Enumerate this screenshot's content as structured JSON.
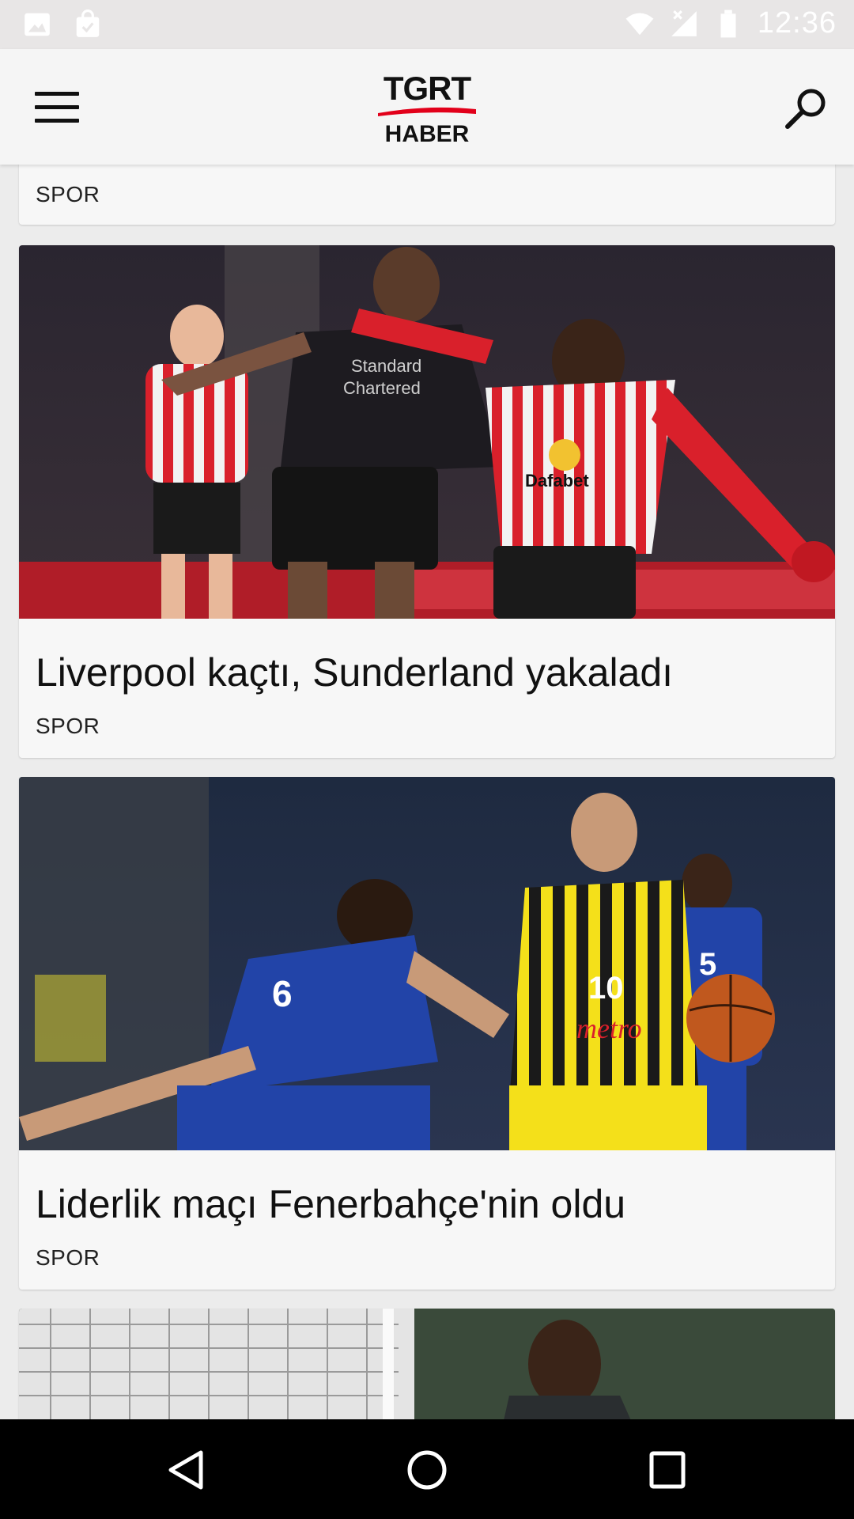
{
  "status_bar": {
    "time": "12:36",
    "icons": [
      "image-icon",
      "shopping-bag-icon",
      "wifi-icon",
      "signal-icon",
      "battery-icon"
    ]
  },
  "app_bar": {
    "logo_line1": "TGRT",
    "logo_line2": "HABER",
    "menu_icon": "hamburger-menu-icon",
    "search_icon": "search-icon"
  },
  "feed": {
    "articles": [
      {
        "title": "",
        "category": "SPOR"
      },
      {
        "title": "Liverpool kaçtı, Sunderland yakaladı",
        "category": "SPOR",
        "image": "football-match-photo"
      },
      {
        "title": "Liderlik maçı Fenerbahçe'nin oldu",
        "category": "SPOR",
        "image": "basketball-match-photo"
      },
      {
        "title": "",
        "category": "",
        "image": "football-player-photo"
      }
    ]
  },
  "nav_bar": {
    "back": "back-icon",
    "home": "home-icon",
    "recents": "recents-icon"
  },
  "colors": {
    "brand_red": "#e2001a",
    "app_bar_bg": "#f5f5f5",
    "card_bg": "#f7f7f7"
  }
}
